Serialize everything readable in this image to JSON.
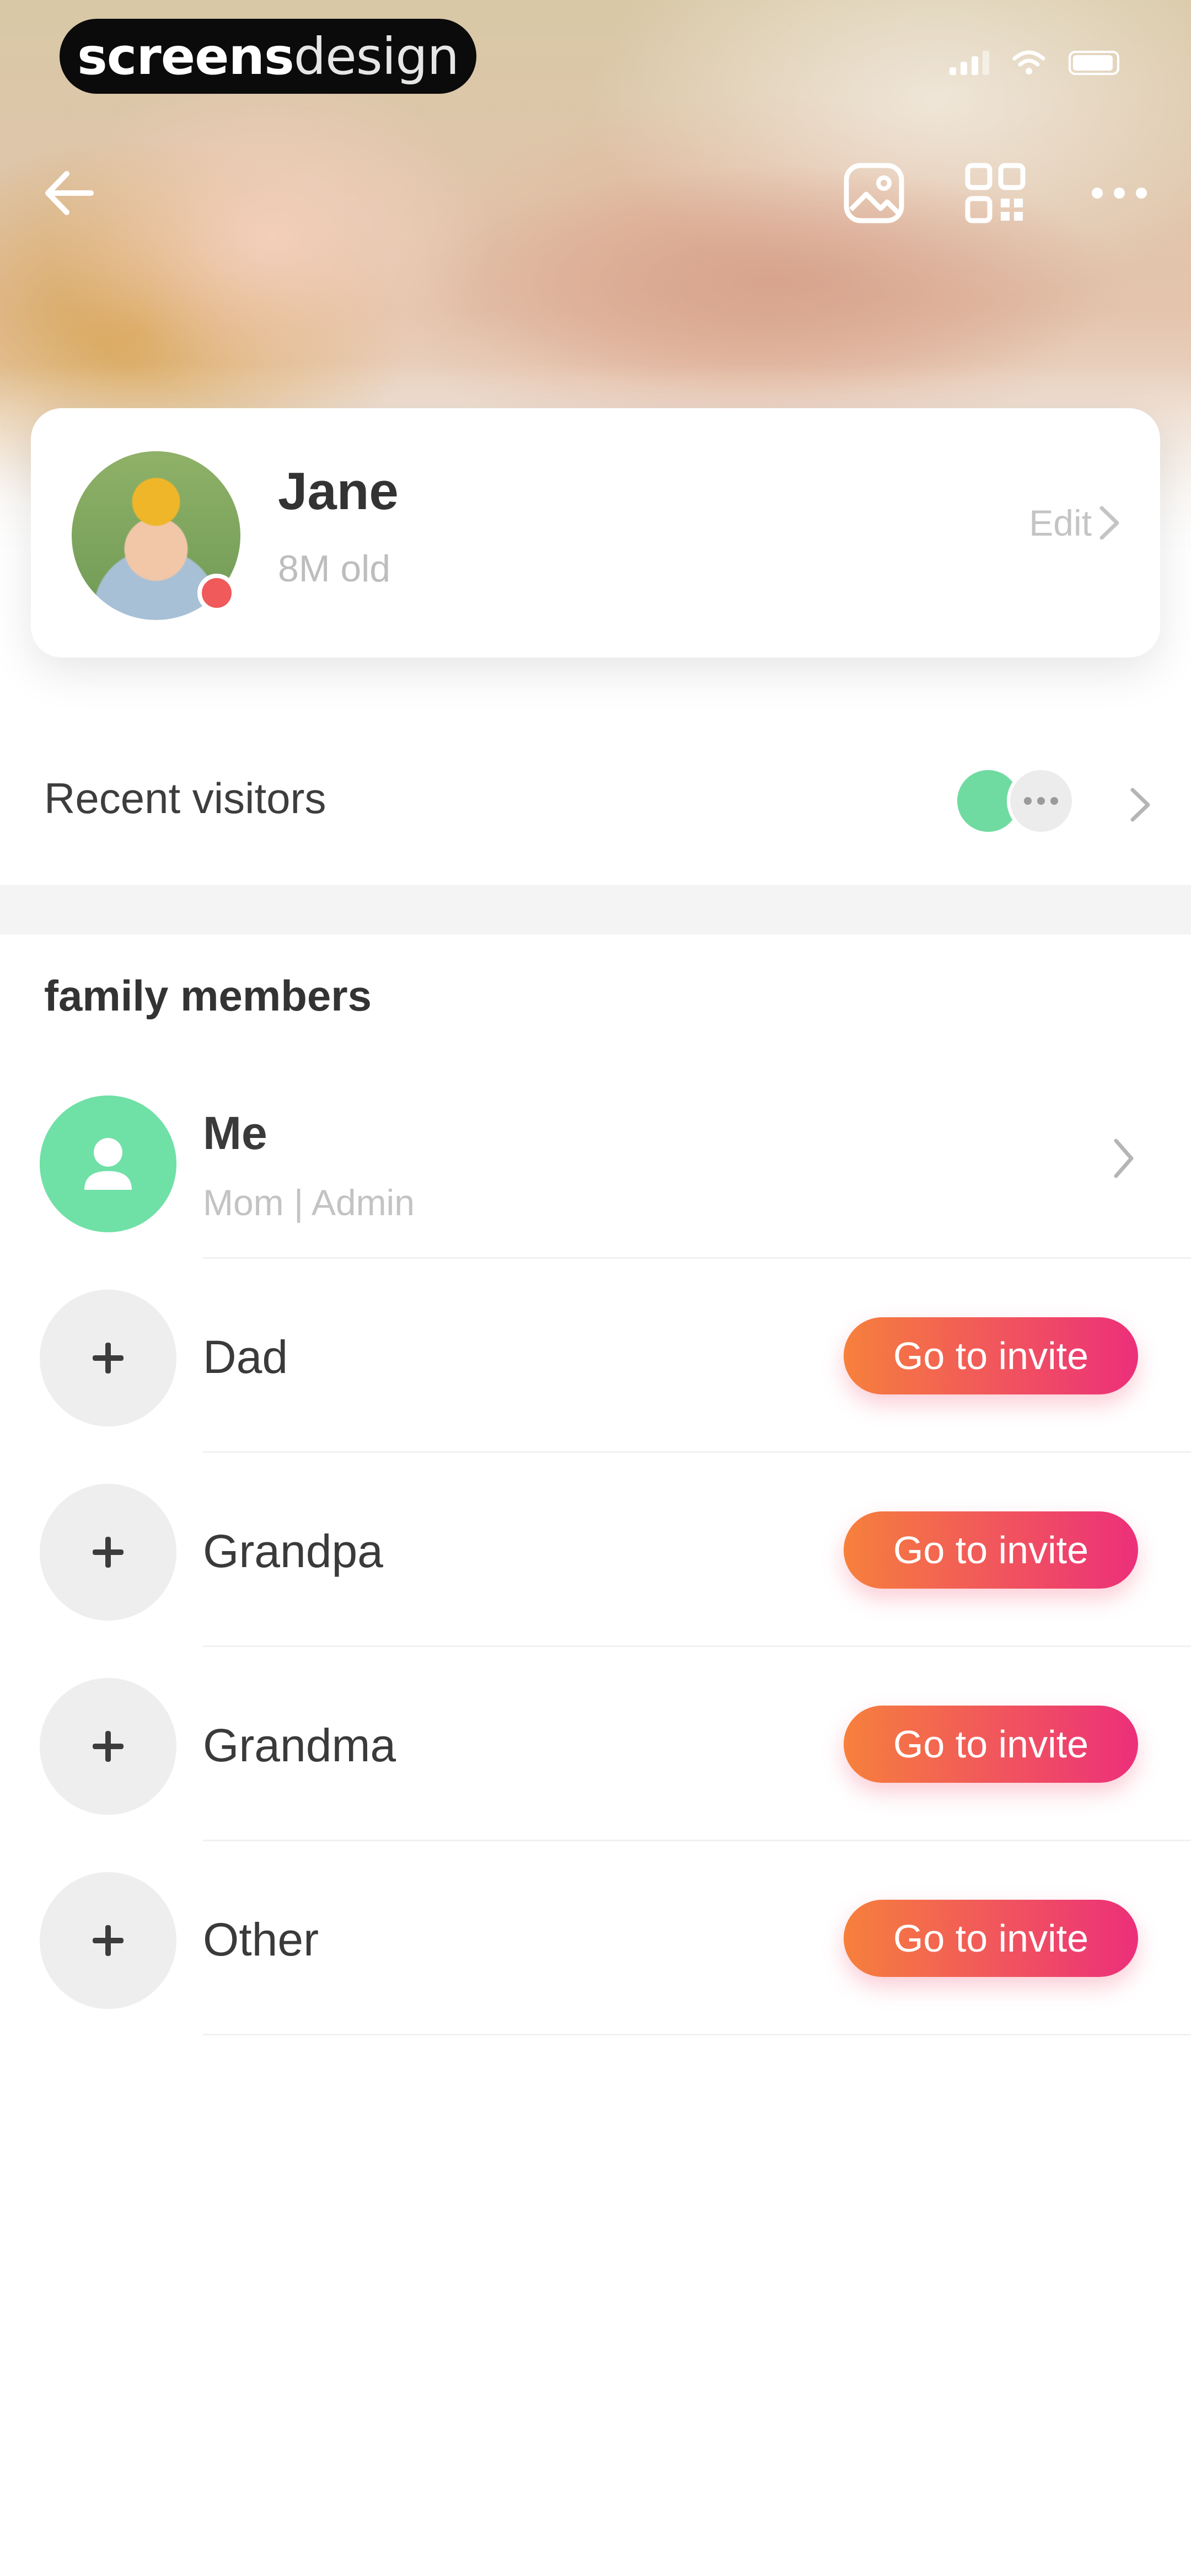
{
  "status_bar": {
    "brand_bold": "screens",
    "brand_light": "design"
  },
  "nav": {
    "back_icon": "back-arrow-icon",
    "photo_icon": "photo-icon",
    "qr_icon": "qr-code-icon",
    "more_icon": "more-dots-icon"
  },
  "profile": {
    "name": "Jane",
    "age": "8M old",
    "edit_label": "Edit"
  },
  "visitors": {
    "label": "Recent visitors"
  },
  "family": {
    "title": "family members",
    "members": [
      {
        "name": "Me",
        "role": "Mom  |  Admin"
      },
      {
        "name": "Dad",
        "action": "Go to invite"
      },
      {
        "name": "Grandpa",
        "action": "Go to invite"
      },
      {
        "name": "Grandma",
        "action": "Go to invite"
      },
      {
        "name": "Other",
        "action": "Go to invite"
      }
    ]
  },
  "colors": {
    "accent_start": "#f6803c",
    "accent_end": "#ec2f7a",
    "me_avatar": "#6fe0a6"
  }
}
